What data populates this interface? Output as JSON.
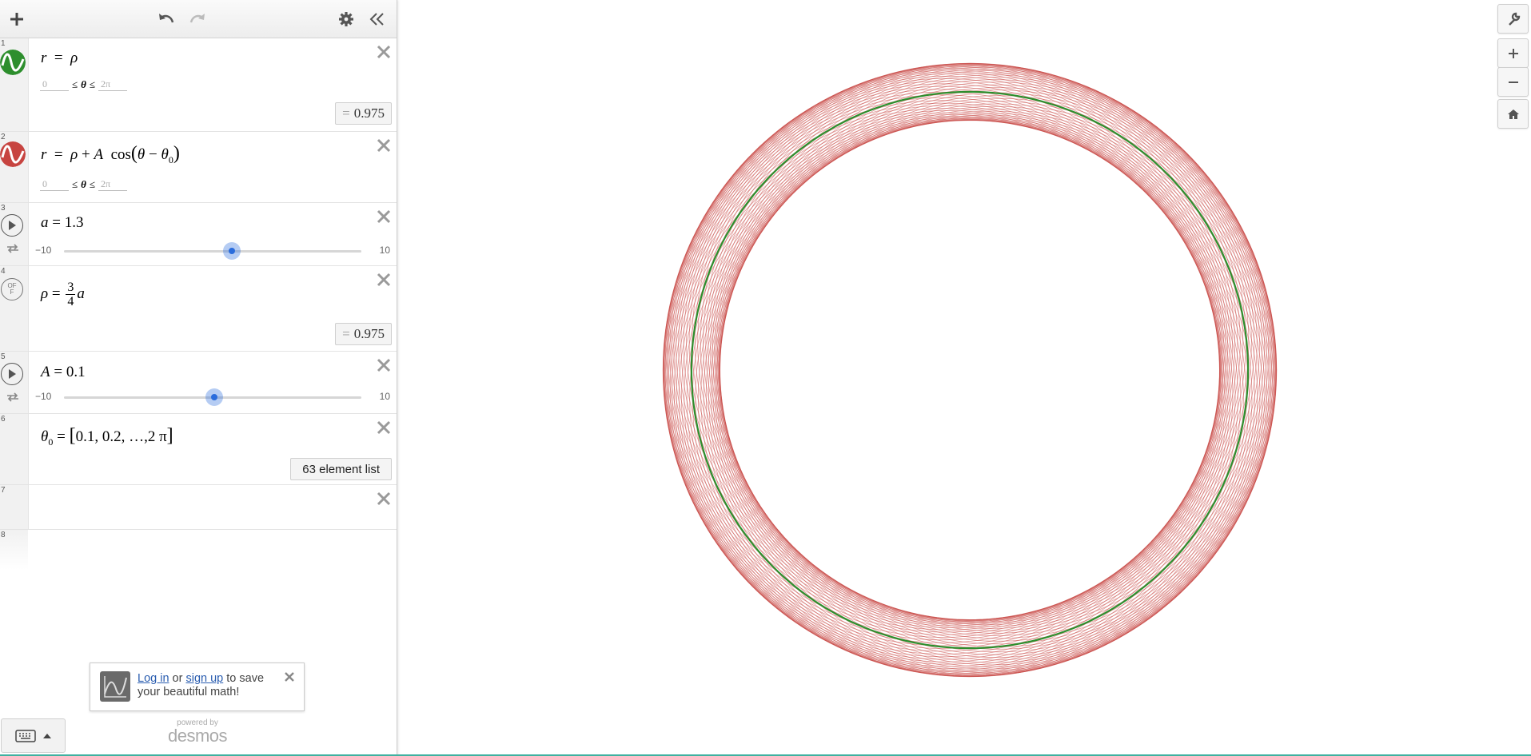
{
  "app": {
    "name": "Desmos Graphing Calculator"
  },
  "toolbar": {
    "add_icon": "plus-icon",
    "undo_icon": "undo-icon",
    "redo_icon": "redo-icon",
    "settings_icon": "gear-icon",
    "collapse_icon": "double-chevron-left-icon"
  },
  "expressions": [
    {
      "line": "1",
      "lhs": "r",
      "rhs": "ρ",
      "domain_min": "0",
      "theta": "θ",
      "domain_max": "2π",
      "value": "0.975",
      "color": "#2d8e2d"
    },
    {
      "line": "2",
      "lhs": "r",
      "rhs_a": "ρ",
      "rhs_b": "A",
      "func": "cos",
      "theta": "θ",
      "theta0": "θ",
      "sub0": "0",
      "domain_min": "0",
      "domain_max": "2π",
      "color": "#c74440"
    },
    {
      "line": "3",
      "lhs": "a",
      "value": "1.3",
      "slider_min": "−10",
      "slider_max": "10",
      "slider_value": 1.3
    },
    {
      "line": "4",
      "lhs": "ρ",
      "num": "3",
      "den": "4",
      "var": "a",
      "value": "0.975"
    },
    {
      "line": "5",
      "lhs": "A",
      "value": "0.1",
      "slider_min": "−10",
      "slider_max": "10",
      "slider_value": 0.1
    },
    {
      "line": "6",
      "lhs": "θ",
      "sub": "0",
      "list": "0.1, 0.2, …,2 π",
      "badge": "63 element list"
    },
    {
      "line": "7"
    },
    {
      "line": "8"
    }
  ],
  "login_banner": {
    "login": "Log in",
    "or": "or",
    "signup": "sign up",
    "rest": "to save your beautiful math!"
  },
  "branding": {
    "powered": "powered by",
    "logo": "desmos"
  },
  "graph": {
    "rho": 0.975,
    "amplitude": 0.1,
    "theta0_count": 63,
    "theta0_step": 0.1,
    "green": "#2d8e2d",
    "red": "#c74440",
    "controls": [
      "wrench-icon",
      "zoom-in-icon",
      "zoom-out-icon",
      "home-icon"
    ]
  },
  "colors": {
    "accent": "#2a6cdc",
    "footer_line": "#3fb1a0"
  }
}
